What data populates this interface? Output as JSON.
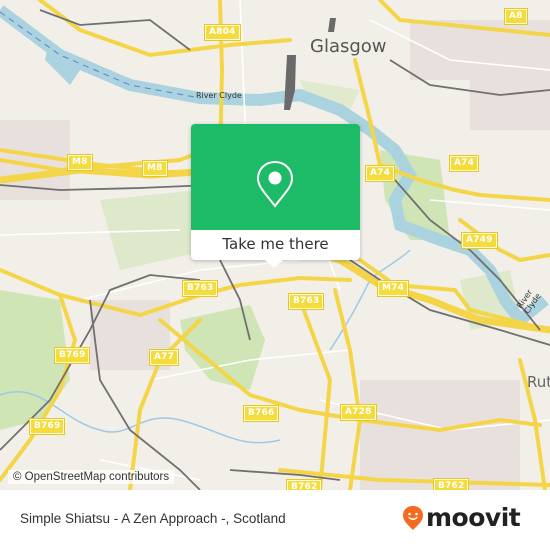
{
  "map": {
    "city_label": "Glasgow",
    "partial_place_label": "Rut",
    "river_labels": [
      "River Clyde",
      "River Clyde"
    ],
    "road_shields": [
      {
        "ref": "A804"
      },
      {
        "ref": "A8"
      },
      {
        "ref": "M8"
      },
      {
        "ref": "M8"
      },
      {
        "ref": "A74"
      },
      {
        "ref": "A74"
      },
      {
        "ref": "A749"
      },
      {
        "ref": "M74"
      },
      {
        "ref": "B763"
      },
      {
        "ref": "B763"
      },
      {
        "ref": "B769"
      },
      {
        "ref": "B769"
      },
      {
        "ref": "A77"
      },
      {
        "ref": "B766"
      },
      {
        "ref": "A728"
      },
      {
        "ref": "B762"
      },
      {
        "ref": "B762"
      }
    ],
    "colors": {
      "land": "#f2efe9",
      "water": "#aad3df",
      "park": "#cde8b0",
      "road": "#f6e05e",
      "rail": "#777777"
    }
  },
  "popup": {
    "icon": "map-pin-icon",
    "button_label": "Take me there",
    "accent_color": "#1dba68"
  },
  "attribution": "© OpenStreetMap contributors",
  "footer": {
    "title": "Simple Shiatsu - A Zen Approach -, Scotland",
    "brand": "moovit",
    "brand_icon": "moovit-logo-icon",
    "brand_color": "#f26b21"
  }
}
